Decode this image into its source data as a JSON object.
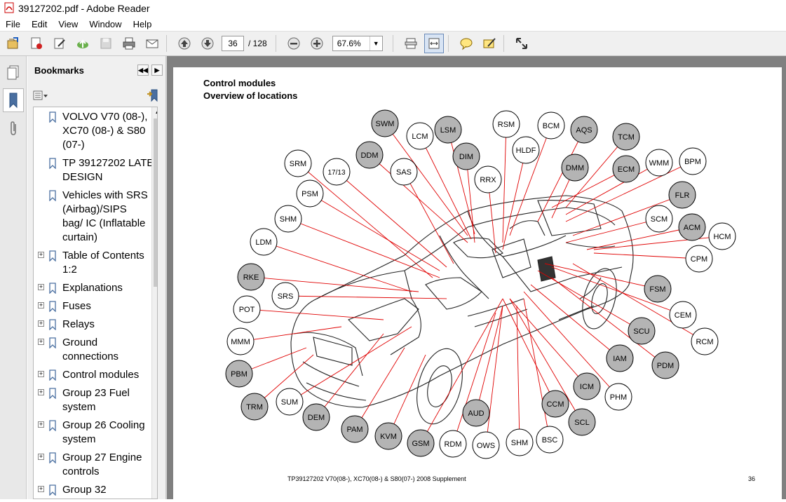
{
  "window": {
    "title": "39127202.pdf - Adobe Reader"
  },
  "menu": [
    "File",
    "Edit",
    "View",
    "Window",
    "Help"
  ],
  "toolbar": {
    "current_page": "36",
    "page_count": "/ 128",
    "zoom": "67.6%"
  },
  "bookmarks": {
    "header": "Bookmarks",
    "items": [
      {
        "label": "VOLVO V70 (08-), XC70 (08-) & S80 (07-)",
        "lines": [
          "VOLVO V70 (08-),",
          "XC70 (08-) & S80",
          "(07-)"
        ],
        "expandable": false
      },
      {
        "label": "TP 39127202 LATE DESIGN",
        "lines": [
          "TP 39127202 LATE",
          "DESIGN"
        ],
        "expandable": false
      },
      {
        "label": "Vehicles with SRS (Airbag)/SIPS bag/ IC (Inflatable curtain)",
        "lines": [
          "Vehicles with SRS",
          "(Airbag)/SIPS",
          "bag/ IC (Inflatable",
          "curtain)"
        ],
        "expandable": false
      },
      {
        "label": "Table of Contents 1:2",
        "lines": [
          "Table of Contents",
          "1:2"
        ],
        "expandable": true
      },
      {
        "label": "Explanations",
        "lines": [
          "Explanations"
        ],
        "expandable": true
      },
      {
        "label": "Fuses",
        "lines": [
          "Fuses"
        ],
        "expandable": true
      },
      {
        "label": "Relays",
        "lines": [
          "Relays"
        ],
        "expandable": true
      },
      {
        "label": "Ground connections",
        "lines": [
          "Ground",
          "connections"
        ],
        "expandable": true
      },
      {
        "label": "Control modules",
        "lines": [
          "Control modules"
        ],
        "expandable": true
      },
      {
        "label": "Group 23 Fuel system",
        "lines": [
          "Group 23 Fuel",
          "system"
        ],
        "expandable": true
      },
      {
        "label": "Group 26 Cooling system",
        "lines": [
          "Group 26 Cooling",
          "system"
        ],
        "expandable": true
      },
      {
        "label": "Group 27 Engine controls",
        "lines": [
          "Group 27 Engine",
          "controls"
        ],
        "expandable": true
      },
      {
        "label": "Group 32",
        "lines": [
          "Group 32"
        ],
        "expandable": true
      }
    ]
  },
  "document": {
    "title_line1": "Control modules",
    "title_line2": "Overview of locations",
    "footer": "TP39127202 V70(08-), XC70(08-) & S80(07-) 2008 Supplement",
    "page_number": "36",
    "modules": [
      {
        "label": "SWM",
        "filled": true
      },
      {
        "label": "LCM",
        "filled": false
      },
      {
        "label": "LSM",
        "filled": true
      },
      {
        "label": "RSM",
        "filled": false
      },
      {
        "label": "BCM",
        "filled": false
      },
      {
        "label": "AQS",
        "filled": true
      },
      {
        "label": "TCM",
        "filled": true
      },
      {
        "label": "DDM",
        "filled": true
      },
      {
        "label": "DIM",
        "filled": true
      },
      {
        "label": "HLDF",
        "filled": false
      },
      {
        "label": "SRM",
        "filled": false
      },
      {
        "label": "17/13",
        "filled": false
      },
      {
        "label": "SAS",
        "filled": false
      },
      {
        "label": "RRX",
        "filled": false
      },
      {
        "label": "DMM",
        "filled": true
      },
      {
        "label": "ECM",
        "filled": true
      },
      {
        "label": "WMM",
        "filled": false
      },
      {
        "label": "BPM",
        "filled": false
      },
      {
        "label": "PSM",
        "filled": false
      },
      {
        "label": "FLR",
        "filled": true
      },
      {
        "label": "SHM",
        "filled": false
      },
      {
        "label": "SCM",
        "filled": false
      },
      {
        "label": "ACM",
        "filled": true
      },
      {
        "label": "HCM",
        "filled": false
      },
      {
        "label": "LDM",
        "filled": false
      },
      {
        "label": "CPM",
        "filled": false
      },
      {
        "label": "RKE",
        "filled": true
      },
      {
        "label": "SRS",
        "filled": false
      },
      {
        "label": "FSM",
        "filled": true
      },
      {
        "label": "POT",
        "filled": false
      },
      {
        "label": "CEM",
        "filled": false
      },
      {
        "label": "MMM",
        "filled": false
      },
      {
        "label": "SCU",
        "filled": true
      },
      {
        "label": "RCM",
        "filled": false
      },
      {
        "label": "IAM",
        "filled": true
      },
      {
        "label": "PDM",
        "filled": true
      },
      {
        "label": "PBM",
        "filled": true
      },
      {
        "label": "ICM",
        "filled": true
      },
      {
        "label": "PHM",
        "filled": false
      },
      {
        "label": "TRM",
        "filled": true
      },
      {
        "label": "SUM",
        "filled": false
      },
      {
        "label": "CCM",
        "filled": true
      },
      {
        "label": "DEM",
        "filled": true
      },
      {
        "label": "AUD",
        "filled": true
      },
      {
        "label": "SCL",
        "filled": true
      },
      {
        "label": "PAM",
        "filled": true
      },
      {
        "label": "KVM",
        "filled": true
      },
      {
        "label": "GSM",
        "filled": true
      },
      {
        "label": "RDM",
        "filled": false
      },
      {
        "label": "OWS",
        "filled": false
      },
      {
        "label": "SHM",
        "filled": false
      },
      {
        "label": "BSC",
        "filled": false
      }
    ]
  },
  "colors": {
    "leader_line": "#e00000",
    "module_fill": "#b4b4b4",
    "viewer_bg": "#808080"
  }
}
